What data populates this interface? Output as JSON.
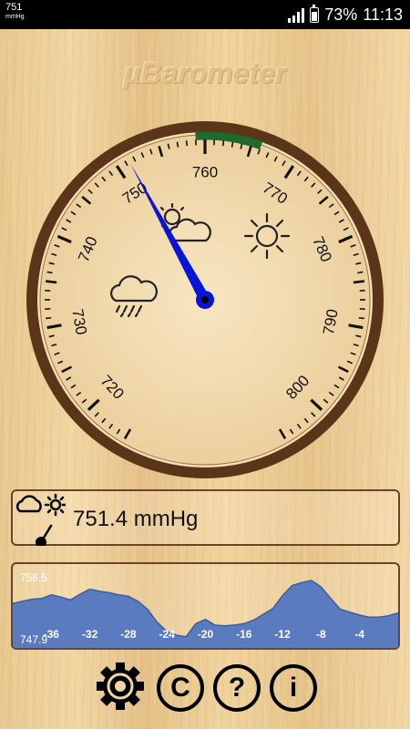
{
  "status_bar": {
    "pressure_value": "751",
    "pressure_unit": "mmHg",
    "battery": "73%",
    "time": "11:13",
    "icons": [
      "signal-icon",
      "battery-icon"
    ]
  },
  "app": {
    "title": "µBarometer"
  },
  "gauge": {
    "min": 715,
    "max": 805,
    "needle_value": 751.4,
    "scale_labels": [
      "720",
      "730",
      "740",
      "750",
      "760",
      "770",
      "780",
      "790",
      "800"
    ],
    "scale_values": [
      720,
      730,
      740,
      750,
      760,
      770,
      780,
      790,
      800
    ],
    "marker_start": 759,
    "marker_end": 766,
    "weather_icons": [
      "rain-cloud-icon",
      "partly-cloudy-icon",
      "sun-icon"
    ],
    "colors": {
      "needle": "#0a14d8",
      "rim": "#5b3517",
      "marker": "#1f6b2e"
    }
  },
  "reading": {
    "text": "751.4 mmHg",
    "icon": "weather-gauge-icon"
  },
  "history": {
    "max_label": "756.5",
    "min_label": "747.9",
    "x_tick_labels": [
      "-36",
      "-32",
      "-28",
      "-24",
      "-20",
      "-16",
      "-12",
      "-8",
      "-4"
    ],
    "fill_color": "#5a7bbf"
  },
  "chart_data": {
    "type": "area",
    "x": [
      -40,
      -39,
      -38,
      -37,
      -36,
      -35,
      -34,
      -33,
      -32,
      -31,
      -30,
      -29,
      -28,
      -27,
      -26,
      -25,
      -24,
      -23,
      -22,
      -21,
      -20,
      -19,
      -18,
      -17,
      -16,
      -15,
      -14,
      -13,
      -12,
      -11,
      -10,
      -9,
      -8,
      -7,
      -6,
      -5,
      -4,
      -3,
      -2,
      -1,
      0
    ],
    "series": [
      {
        "values": [
          753.3,
          753.6,
          753.9,
          754.0,
          754.5,
          754.2,
          753.8,
          754.6,
          755.3,
          755.0,
          754.8,
          754.5,
          754.3,
          753.6,
          752.5,
          750.7,
          749.4,
          748.9,
          748.7,
          750.5,
          751.1,
          750.3,
          750.2,
          750.3,
          750.5,
          751.0,
          751.8,
          752.6,
          754.4,
          755.8,
          756.2,
          756.5,
          755.6,
          754.0,
          752.5,
          752.1,
          751.7,
          751.4,
          751.4,
          751.6,
          752.0
        ]
      }
    ],
    "ylim": [
      747.9,
      756.5
    ],
    "xlabel": "",
    "ylabel": ""
  },
  "toolbar": {
    "buttons": [
      {
        "name": "settings-button",
        "icon": "gear-icon",
        "glyph": ""
      },
      {
        "name": "copyright-button",
        "icon": "copyright-icon",
        "glyph": "C"
      },
      {
        "name": "help-button",
        "icon": "help-icon",
        "glyph": "?"
      },
      {
        "name": "info-button",
        "icon": "info-icon",
        "glyph": "i"
      }
    ]
  }
}
